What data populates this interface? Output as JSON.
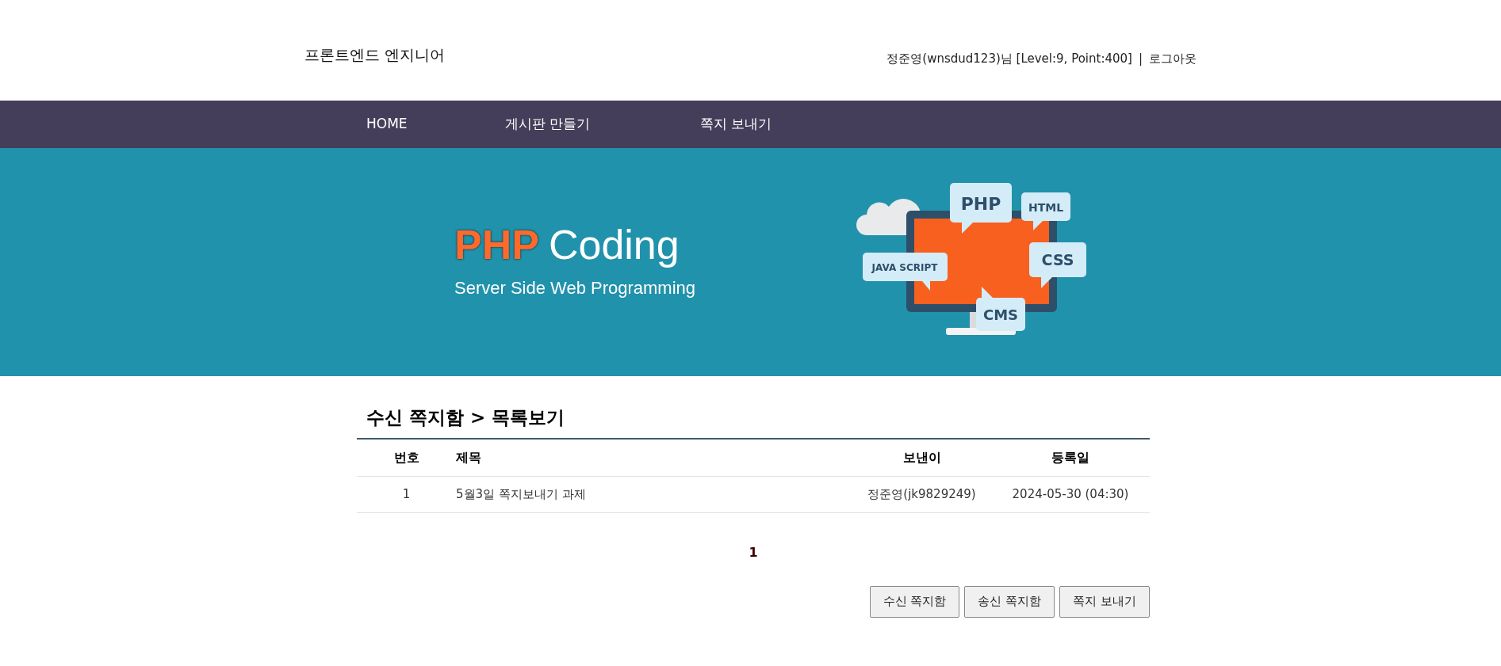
{
  "header": {
    "site_title": "프론트엔드 엔지니어",
    "user_info": "정준영(wnsdud123)님 [Level:9, Point:400]",
    "separator": "|",
    "logout": "로그아웃"
  },
  "nav": [
    {
      "label": "HOME"
    },
    {
      "label": "게시판 만들기"
    },
    {
      "label": "쪽지 보내기"
    }
  ],
  "banner": {
    "title_accent": "PHP",
    "title_rest": "Coding",
    "subtitle": "Server Side Web Programming",
    "bubbles": [
      "PHP",
      "HTML",
      "JAVA SCRIPT",
      "CSS",
      "CMS"
    ]
  },
  "page_heading": "수신 쪽지함 > 목록보기",
  "table": {
    "columns": [
      "번호",
      "제목",
      "보낸이",
      "등록일"
    ],
    "rows": [
      {
        "number": "1",
        "subject": "5월3일 쪽지보내기 과제",
        "sender": "정준영(jk9829249)",
        "date": "2024-05-30 (04:30)"
      }
    ]
  },
  "pagination": [
    {
      "label": "1",
      "selected": true
    }
  ],
  "buttons": [
    "수신 쪽지함",
    "송신 쪽지함",
    "쪽지 보내기"
  ]
}
